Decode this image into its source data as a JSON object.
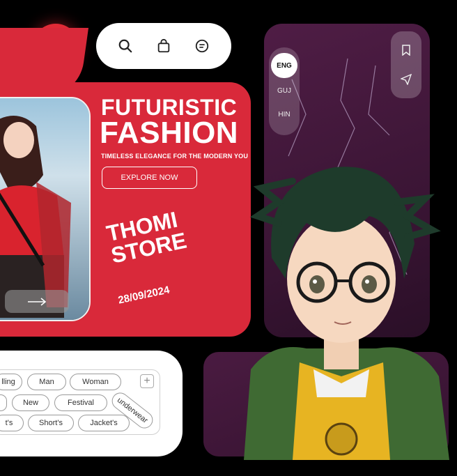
{
  "nav": {
    "menu_icon": "grid-icon",
    "actions": [
      {
        "icon": "search-icon"
      },
      {
        "icon": "bag-icon"
      },
      {
        "icon": "chat-icon"
      }
    ]
  },
  "hero": {
    "title_line1": "FUTURISTIC",
    "title_line2": "FASHION",
    "subtitle": "TIMELESS ELEGANCE FOR THE MODERN YOU",
    "cta_label": "EXPLORE NOW",
    "store_line1": "THOMI",
    "store_line2": "STORE",
    "date": "28/09/2024",
    "arrow_icon": "arrow-right-icon"
  },
  "tags": {
    "row1": [
      "lling",
      "Man",
      "Woman"
    ],
    "row2": [
      "New",
      "Festival",
      "underwear"
    ],
    "row3": [
      "t's",
      "Short's",
      "Jacket's"
    ],
    "add_label": "+"
  },
  "languages": [
    {
      "code": "ENG",
      "active": true
    },
    {
      "code": "GUJ",
      "active": false
    },
    {
      "code": "HIN",
      "active": false
    }
  ],
  "side_actions": [
    {
      "icon": "bookmark-icon"
    },
    {
      "icon": "send-icon"
    }
  ],
  "colors": {
    "accent_red": "#d9293a",
    "panel_purple": "#3b1535",
    "background": "#000000",
    "white": "#ffffff"
  }
}
